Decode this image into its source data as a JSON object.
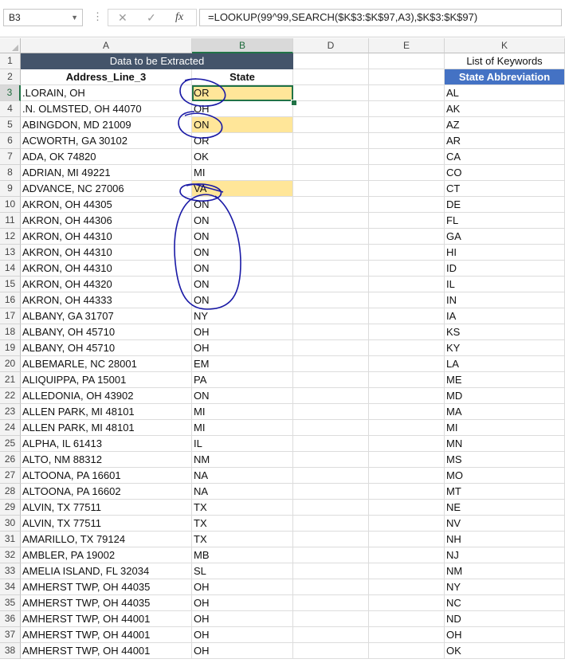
{
  "formula_bar": {
    "name_box": "B3",
    "cancel_icon": "✕",
    "enter_icon": "✓",
    "fx_label": "fx",
    "formula": "=LOOKUP(99^99,SEARCH($K$3:$K$97,A3),$K$3:$K$97)"
  },
  "columns": [
    "A",
    "B",
    "D",
    "E",
    "K"
  ],
  "header": {
    "merged_title": "Data to be Extracted",
    "col_a": "Address_Line_3",
    "col_b": "State",
    "kw_title": "List of Keywords",
    "kw_header": "State Abbreviation"
  },
  "rows": [
    {
      "n": "3",
      "a": ".LORAIN, OH",
      "b": "OR",
      "k": "AL"
    },
    {
      "n": "4",
      "a": ".N. OLMSTED, OH 44070",
      "b": "OH",
      "k": "AK"
    },
    {
      "n": "5",
      "a": "ABINGDON, MD 21009",
      "b": "ON",
      "k": "AZ"
    },
    {
      "n": "6",
      "a": "ACWORTH, GA 30102",
      "b": "OR",
      "k": "AR"
    },
    {
      "n": "7",
      "a": "ADA, OK 74820",
      "b": "OK",
      "k": "CA"
    },
    {
      "n": "8",
      "a": "ADRIAN, MI 49221",
      "b": "MI",
      "k": "CO"
    },
    {
      "n": "9",
      "a": "ADVANCE, NC 27006",
      "b": "VA",
      "k": "CT"
    },
    {
      "n": "10",
      "a": "AKRON, OH 44305",
      "b": "ON",
      "k": "DE"
    },
    {
      "n": "11",
      "a": "AKRON, OH 44306",
      "b": "ON",
      "k": "FL"
    },
    {
      "n": "12",
      "a": "AKRON, OH 44310",
      "b": "ON",
      "k": "GA"
    },
    {
      "n": "13",
      "a": "AKRON, OH 44310",
      "b": "ON",
      "k": "HI"
    },
    {
      "n": "14",
      "a": "AKRON, OH 44310",
      "b": "ON",
      "k": "ID"
    },
    {
      "n": "15",
      "a": "AKRON, OH 44320",
      "b": "ON",
      "k": "IL"
    },
    {
      "n": "16",
      "a": "AKRON, OH 44333",
      "b": "ON",
      "k": "IN"
    },
    {
      "n": "17",
      "a": "ALBANY, GA 31707",
      "b": "NY",
      "k": "IA"
    },
    {
      "n": "18",
      "a": "ALBANY, OH 45710",
      "b": "OH",
      "k": "KS"
    },
    {
      "n": "19",
      "a": "ALBANY, OH 45710",
      "b": "OH",
      "k": "KY"
    },
    {
      "n": "20",
      "a": "ALBEMARLE, NC 28001",
      "b": "EM",
      "k": "LA"
    },
    {
      "n": "21",
      "a": "ALIQUIPPA, PA 15001",
      "b": "PA",
      "k": "ME"
    },
    {
      "n": "22",
      "a": "ALLEDONIA, OH 43902",
      "b": "ON",
      "k": "MD"
    },
    {
      "n": "23",
      "a": "ALLEN PARK, MI 48101",
      "b": "MI",
      "k": "MA"
    },
    {
      "n": "24",
      "a": "ALLEN PARK, MI 48101",
      "b": "MI",
      "k": "MI"
    },
    {
      "n": "25",
      "a": "ALPHA, IL 61413",
      "b": "IL",
      "k": "MN"
    },
    {
      "n": "26",
      "a": "ALTO, NM 88312",
      "b": "NM",
      "k": "MS"
    },
    {
      "n": "27",
      "a": "ALTOONA, PA 16601",
      "b": "NA",
      "k": "MO"
    },
    {
      "n": "28",
      "a": "ALTOONA, PA 16602",
      "b": "NA",
      "k": "MT"
    },
    {
      "n": "29",
      "a": "ALVIN, TX 77511",
      "b": "TX",
      "k": "NE"
    },
    {
      "n": "30",
      "a": "ALVIN, TX 77511",
      "b": "TX",
      "k": "NV"
    },
    {
      "n": "31",
      "a": "AMARILLO, TX 79124",
      "b": "TX",
      "k": "NH"
    },
    {
      "n": "32",
      "a": "AMBLER, PA 19002",
      "b": "MB",
      "k": "NJ"
    },
    {
      "n": "33",
      "a": "AMELIA ISLAND, FL 32034",
      "b": "SL",
      "k": "NM"
    },
    {
      "n": "34",
      "a": "AMHERST TWP, OH 44035",
      "b": "OH",
      "k": "NY"
    },
    {
      "n": "35",
      "a": "AMHERST TWP, OH 44035",
      "b": "OH",
      "k": "NC"
    },
    {
      "n": "36",
      "a": "AMHERST TWP, OH 44001",
      "b": "OH",
      "k": "ND"
    },
    {
      "n": "37",
      "a": "AMHERST TWP, OH 44001",
      "b": "OH",
      "k": "OH"
    },
    {
      "n": "38",
      "a": "AMHERST TWP, OH 44001",
      "b": "OH",
      "k": "OK"
    }
  ],
  "colors": {
    "merged_header": "#44546a",
    "keyword_header": "#4472c4",
    "highlight": "#ffe699",
    "selection": "#217346",
    "annotation": "#1a1aa6"
  }
}
